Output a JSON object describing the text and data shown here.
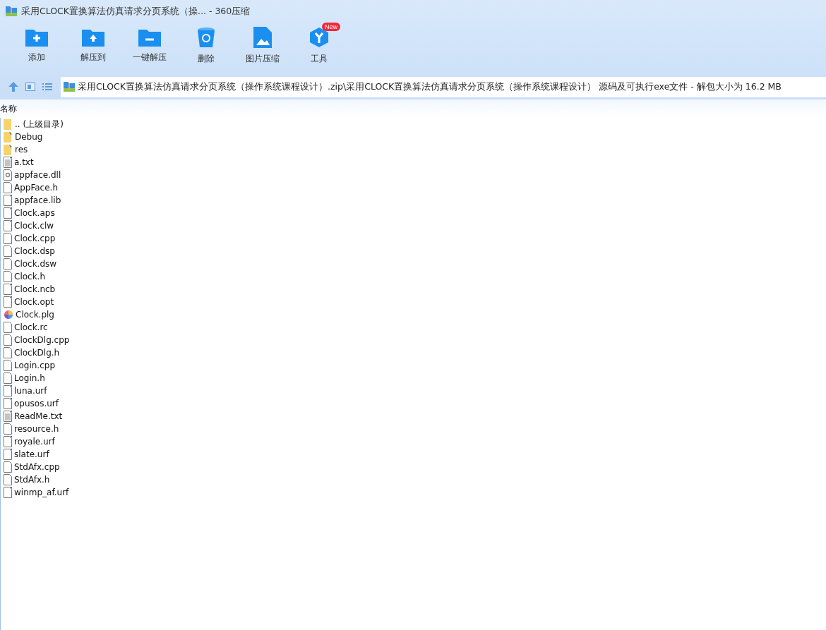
{
  "window": {
    "title": "采用CLOCK置换算法仿真请求分页系统（操...  -  360压缩"
  },
  "toolbar": [
    {
      "label": "添加",
      "kind": "add"
    },
    {
      "label": "解压到",
      "kind": "extract"
    },
    {
      "label": "一键解压",
      "kind": "oneclick"
    },
    {
      "label": "删除",
      "kind": "delete"
    },
    {
      "label": "图片压缩",
      "kind": "image"
    },
    {
      "label": "工具",
      "kind": "tools",
      "badge": "New"
    }
  ],
  "address": {
    "path": "采用CLOCK置换算法仿真请求分页系统（操作系统课程设计）.zip\\采用CLOCK置换算法仿真请求分页系统（操作系统课程设计） 源码及可执行exe文件 - 解包大小为 16.2 MB"
  },
  "table": {
    "columns": [
      "名称"
    ],
    "rows": [
      {
        "name": ".. (上级目录)",
        "kind": "folder",
        "shortcut": false
      },
      {
        "name": "Debug",
        "kind": "folder",
        "shortcut": true
      },
      {
        "name": "res",
        "kind": "folder",
        "shortcut": true
      },
      {
        "name": "a.txt",
        "kind": "text",
        "shortcut": true
      },
      {
        "name": "appface.dll",
        "kind": "dll",
        "shortcut": false
      },
      {
        "name": "AppFace.h",
        "kind": "file",
        "shortcut": false
      },
      {
        "name": "appface.lib",
        "kind": "file",
        "shortcut": true
      },
      {
        "name": "Clock.aps",
        "kind": "file",
        "shortcut": true
      },
      {
        "name": "Clock.clw",
        "kind": "file",
        "shortcut": true
      },
      {
        "name": "Clock.cpp",
        "kind": "file",
        "shortcut": false
      },
      {
        "name": "Clock.dsp",
        "kind": "file",
        "shortcut": false
      },
      {
        "name": "Clock.dsw",
        "kind": "file",
        "shortcut": false
      },
      {
        "name": "Clock.h",
        "kind": "file",
        "shortcut": false
      },
      {
        "name": "Clock.ncb",
        "kind": "file",
        "shortcut": true
      },
      {
        "name": "Clock.opt",
        "kind": "file",
        "shortcut": true
      },
      {
        "name": "Clock.plg",
        "kind": "paint",
        "shortcut": false
      },
      {
        "name": "Clock.rc",
        "kind": "file",
        "shortcut": false
      },
      {
        "name": "ClockDlg.cpp",
        "kind": "file",
        "shortcut": false
      },
      {
        "name": "ClockDlg.h",
        "kind": "file",
        "shortcut": false
      },
      {
        "name": "Login.cpp",
        "kind": "file",
        "shortcut": false
      },
      {
        "name": "Login.h",
        "kind": "file",
        "shortcut": false
      },
      {
        "name": "luna.urf",
        "kind": "file",
        "shortcut": true
      },
      {
        "name": "opusos.urf",
        "kind": "file",
        "shortcut": true
      },
      {
        "name": "ReadMe.txt",
        "kind": "text",
        "shortcut": true
      },
      {
        "name": "resource.h",
        "kind": "file",
        "shortcut": false
      },
      {
        "name": "royale.urf",
        "kind": "file",
        "shortcut": true
      },
      {
        "name": "slate.urf",
        "kind": "file",
        "shortcut": true
      },
      {
        "name": "StdAfx.cpp",
        "kind": "file",
        "shortcut": false
      },
      {
        "name": "StdAfx.h",
        "kind": "file",
        "shortcut": false
      },
      {
        "name": "winmp_af.urf",
        "kind": "file",
        "shortcut": true
      }
    ]
  }
}
